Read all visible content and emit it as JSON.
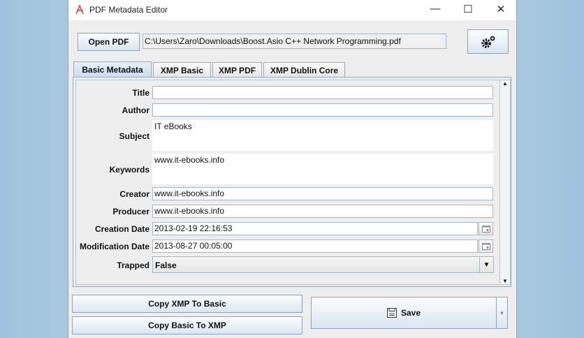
{
  "window": {
    "title": "PDF Metadata Editor",
    "minimize": "—",
    "maximize": "☐",
    "close": "✕"
  },
  "toolbar": {
    "open_label": "Open PDF",
    "file_path": "C:\\Users\\Zaro\\Downloads\\Boost.Asio C++ Network Programming.pdf",
    "settings_icon": "gears-icon"
  },
  "tabs": [
    {
      "label": "Basic Metadata",
      "active": true
    },
    {
      "label": "XMP Basic"
    },
    {
      "label": "XMP PDF"
    },
    {
      "label": "XMP Dublin Core"
    }
  ],
  "fields": {
    "title": {
      "label": "Title",
      "value": ""
    },
    "author": {
      "label": "Author",
      "value": ""
    },
    "subject": {
      "label": "Subject",
      "value": "IT eBooks"
    },
    "keywords": {
      "label": "Keywords",
      "value": "www.it-ebooks.info"
    },
    "creator": {
      "label": "Creator",
      "value": "www.it-ebooks.info"
    },
    "producer": {
      "label": "Producer",
      "value": "www.it-ebooks.info"
    },
    "creation_date": {
      "label": "Creation Date",
      "value": "2013-02-19 22:16:53"
    },
    "modification_date": {
      "label": "Modification Date",
      "value": "2013-08-27 00:05:00"
    },
    "trapped": {
      "label": "Trapped",
      "value": "False"
    }
  },
  "actions": {
    "copy_xmp_to_basic": "Copy XMP To Basic",
    "copy_basic_to_xmp": "Copy Basic To XMP",
    "save": "Save"
  }
}
